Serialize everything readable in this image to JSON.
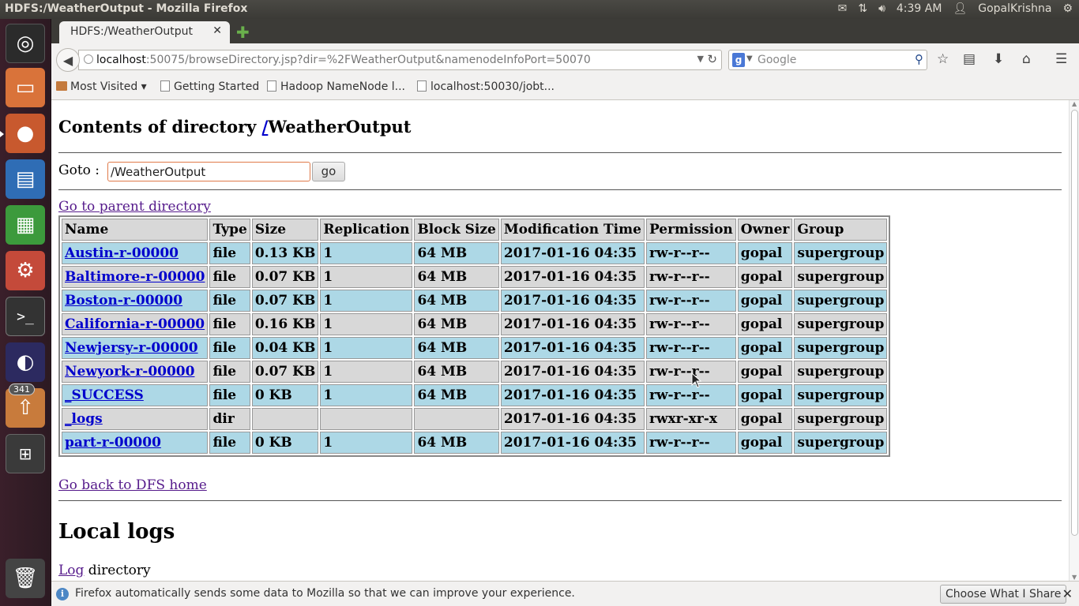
{
  "topbar": {
    "window_title": "HDFS:/WeatherOutput - Mozilla Firefox",
    "time": "4:39 AM",
    "user": "GopalKrishna"
  },
  "launcher": {
    "badge_count": "341",
    "items": [
      "ubuntu-dash-icon",
      "files-icon",
      "firefox-icon",
      "writer-icon",
      "calc-icon",
      "settings-icon",
      "terminal-icon",
      "eclipse-icon",
      "software-updater-icon",
      "workspace-switcher-icon",
      "trash-icon"
    ]
  },
  "browser": {
    "tab_title": "HDFS:/WeatherOutput",
    "url_host": "localhost",
    "url_rest": ":50075/browseDirectory.jsp?dir=%2FWeatherOutput&namenodeInfoPort=50070",
    "search_placeholder": "Google",
    "bookmarks": [
      "Most Visited",
      "Getting Started",
      "Hadoop NameNode l...",
      "localhost:50030/jobt..."
    ]
  },
  "page": {
    "title_prefix": "Contents of directory ",
    "title_slash": "/",
    "title_dir": "WeatherOutput",
    "goto_label": "Goto :",
    "goto_value": "/WeatherOutput",
    "go_button": "go",
    "parent_link": "Go to parent directory",
    "columns": [
      "Name",
      "Type",
      "Size",
      "Replication",
      "Block Size",
      "Modification Time",
      "Permission",
      "Owner",
      "Group"
    ],
    "rows": [
      {
        "name": "Austin-r-00000",
        "type": "file",
        "size": "0.13 KB",
        "replication": "1",
        "block": "64 MB",
        "mtime": "2017-01-16 04:35",
        "perm": "rw-r--r--",
        "owner": "gopal",
        "group": "supergroup"
      },
      {
        "name": "Baltimore-r-00000",
        "type": "file",
        "size": "0.07 KB",
        "replication": "1",
        "block": "64 MB",
        "mtime": "2017-01-16 04:35",
        "perm": "rw-r--r--",
        "owner": "gopal",
        "group": "supergroup"
      },
      {
        "name": "Boston-r-00000",
        "type": "file",
        "size": "0.07 KB",
        "replication": "1",
        "block": "64 MB",
        "mtime": "2017-01-16 04:35",
        "perm": "rw-r--r--",
        "owner": "gopal",
        "group": "supergroup"
      },
      {
        "name": "California-r-00000",
        "type": "file",
        "size": "0.16 KB",
        "replication": "1",
        "block": "64 MB",
        "mtime": "2017-01-16 04:35",
        "perm": "rw-r--r--",
        "owner": "gopal",
        "group": "supergroup"
      },
      {
        "name": "Newjersy-r-00000",
        "type": "file",
        "size": "0.04 KB",
        "replication": "1",
        "block": "64 MB",
        "mtime": "2017-01-16 04:35",
        "perm": "rw-r--r--",
        "owner": "gopal",
        "group": "supergroup"
      },
      {
        "name": "Newyork-r-00000",
        "type": "file",
        "size": "0.07 KB",
        "replication": "1",
        "block": "64 MB",
        "mtime": "2017-01-16 04:35",
        "perm": "rw-r--r--",
        "owner": "gopal",
        "group": "supergroup"
      },
      {
        "name": "_SUCCESS",
        "type": "file",
        "size": "0 KB",
        "replication": "1",
        "block": "64 MB",
        "mtime": "2017-01-16 04:35",
        "perm": "rw-r--r--",
        "owner": "gopal",
        "group": "supergroup"
      },
      {
        "name": "_logs",
        "type": "dir",
        "size": "",
        "replication": "",
        "block": "",
        "mtime": "2017-01-16 04:35",
        "perm": "rwxr-xr-x",
        "owner": "gopal",
        "group": "supergroup"
      },
      {
        "name": "part-r-00000",
        "type": "file",
        "size": "0 KB",
        "replication": "1",
        "block": "64 MB",
        "mtime": "2017-01-16 04:35",
        "perm": "rw-r--r--",
        "owner": "gopal",
        "group": "supergroup"
      }
    ],
    "dfs_home_link": "Go back to DFS home",
    "local_logs_heading": "Local logs",
    "log_link": "Log",
    "log_suffix": " directory"
  },
  "notification": {
    "message": "Firefox automatically sends some data to Mozilla so that we can improve your experience.",
    "button": "Choose What I Share"
  },
  "colors": {
    "row_alt_blue": "#add8e6",
    "row_alt_gray": "#d8d8d8",
    "link": "#0000cc",
    "visited_link": "#551a8b"
  }
}
